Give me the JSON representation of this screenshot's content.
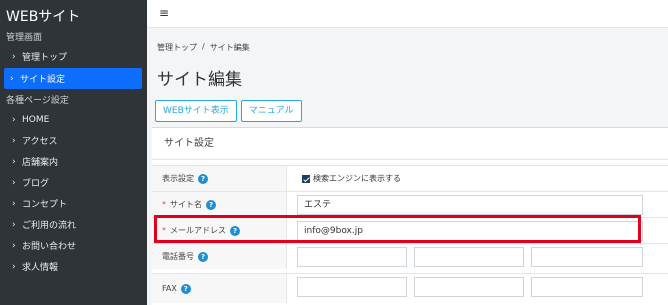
{
  "brand": "WEBサイト",
  "sidebar": {
    "section1": "管理画面",
    "items1": [
      {
        "label": "管理トップ",
        "active": false
      },
      {
        "label": "サイト設定",
        "active": true
      }
    ],
    "section2": "各種ページ設定",
    "items2": [
      {
        "label": "HOME"
      },
      {
        "label": "アクセス"
      },
      {
        "label": "店舗案内"
      },
      {
        "label": "ブログ"
      },
      {
        "label": "コンセプト"
      },
      {
        "label": "ご利用の流れ"
      },
      {
        "label": "お問い合わせ"
      },
      {
        "label": "求人情報"
      }
    ]
  },
  "topbar": {
    "menu_icon": "≡"
  },
  "breadcrumb": {
    "home": "管理トップ",
    "sep": "/",
    "current": "サイト編集"
  },
  "page_title": "サイト編集",
  "tabs": {
    "website": "WEBサイト表示",
    "manual": "マニュアル"
  },
  "card": {
    "header": "サイト設定"
  },
  "form": {
    "display": {
      "label": "表示設定",
      "checkbox_label": "検索エンジンに表示する"
    },
    "site_name": {
      "required": "*",
      "label": "サイト名",
      "value": "エステ"
    },
    "email": {
      "required": "*",
      "label": "メールアドレス",
      "value": "info@9box.jp"
    },
    "phone": {
      "label": "電話番号",
      "values": [
        "",
        "",
        ""
      ]
    },
    "fax": {
      "label": "FAX",
      "values": [
        "",
        "",
        ""
      ]
    }
  },
  "colors": {
    "sidebar": "#2f3438",
    "active": "#0d6efd",
    "accent": "#29a8e0",
    "highlight": "#e0001b"
  }
}
